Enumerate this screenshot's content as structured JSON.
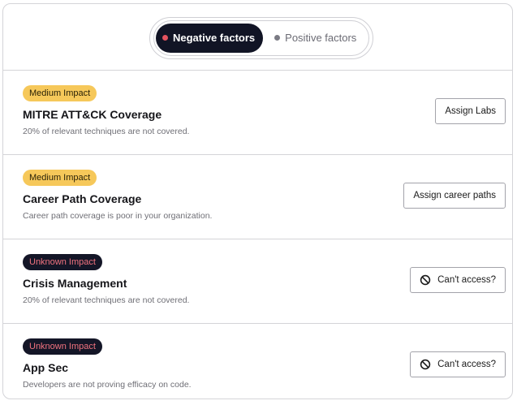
{
  "toggle": {
    "active_label": "Negative factors",
    "inactive_label": "Positive factors",
    "active_dot_color": "#e4535f",
    "inactive_dot_color": "#7b7b84"
  },
  "factors": [
    {
      "impact": "Medium Impact",
      "impact_level": "medium",
      "title": "MITRE ATT&CK Coverage",
      "description": "20% of relevant techniques are not covered.",
      "action": "Assign Labs",
      "action_icon": ""
    },
    {
      "impact": "Medium Impact",
      "impact_level": "medium",
      "title": "Career Path Coverage",
      "description": "Career path coverage is poor in your organization.",
      "action": "Assign career paths",
      "action_icon": ""
    },
    {
      "impact": "Unknown Impact",
      "impact_level": "unknown",
      "title": "Crisis Management",
      "description": "20% of relevant techniques are not covered.",
      "action": "Can't access?",
      "action_icon": "ban-icon"
    },
    {
      "impact": "Unknown Impact",
      "impact_level": "unknown",
      "title": "App Sec",
      "description": "Developers are not proving efficacy on code.",
      "action": "Can't access?",
      "action_icon": "ban-icon"
    }
  ]
}
